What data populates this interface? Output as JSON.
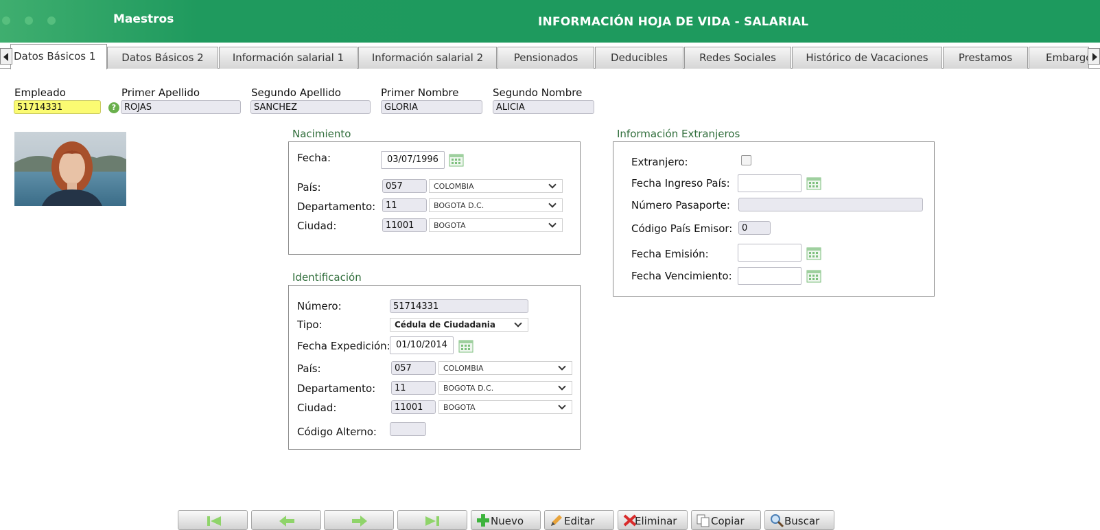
{
  "header": {
    "module": "Maestros",
    "title": "INFORMACIÓN HOJA DE VIDA - SALARIAL"
  },
  "tabs": [
    {
      "label": "Datos Básicos 1",
      "active": true
    },
    {
      "label": "Datos Básicos 2"
    },
    {
      "label": "Información salarial 1"
    },
    {
      "label": "Información salarial 2"
    },
    {
      "label": "Pensionados"
    },
    {
      "label": "Deducibles"
    },
    {
      "label": "Redes Sociales"
    },
    {
      "label": "Histórico de Vacaciones"
    },
    {
      "label": "Prestamos"
    },
    {
      "label": "Embargos"
    }
  ],
  "employee": {
    "label": "Empleado",
    "value": "51714331",
    "first_surname_label": "Primer Apellido",
    "first_surname": "ROJAS",
    "second_surname_label": "Segundo Apellido",
    "second_surname": "SANCHEZ",
    "first_name_label": "Primer Nombre",
    "first_name": "GLORIA",
    "second_name_label": "Segundo Nombre",
    "second_name": "ALICIA"
  },
  "birth": {
    "title": "Nacimiento",
    "date_label": "Fecha:",
    "date": "03/07/1996",
    "country_label": "País:",
    "country_code": "057",
    "country_name": "COLOMBIA",
    "dept_label": "Departamento:",
    "dept_code": "11",
    "dept_name": "BOGOTA D.C.",
    "city_label": "Ciudad:",
    "city_code": "11001",
    "city_name": "BOGOTA"
  },
  "identification": {
    "title": "Identificación",
    "number_label": "Número:",
    "number": "51714331",
    "type_label": "Tipo:",
    "type": "Cédula de Ciudadania",
    "issue_date_label": "Fecha Expedición:",
    "issue_date": "01/10/2014",
    "country_label": "País:",
    "country_code": "057",
    "country_name": "COLOMBIA",
    "dept_label": "Departamento:",
    "dept_code": "11",
    "dept_name": "BOGOTA D.C.",
    "city_label": "Ciudad:",
    "city_code": "11001",
    "city_name": "BOGOTA",
    "alt_code_label": "Código Alterno:",
    "alt_code": ""
  },
  "foreign": {
    "title": "Información Extranjeros",
    "foreigner_label": "Extranjero:",
    "foreigner_checked": false,
    "entry_date_label": "Fecha Ingreso País:",
    "entry_date": "",
    "passport_label": "Número Pasaporte:",
    "passport": "",
    "issuer_country_label": "Código País Emisor:",
    "issuer_country": "0",
    "issue_date_label": "Fecha Emisión:",
    "issue_date": "",
    "expiry_date_label": "Fecha Vencimiento:",
    "expiry_date": ""
  },
  "toolbar": {
    "new_label": "Nuevo",
    "edit_label": "Editar",
    "delete_label": "Eliminar",
    "copy_label": "Copiar",
    "search_label": "Buscar"
  },
  "colors": {
    "header": "#1d9a5e",
    "section_title": "#2f6d3a",
    "employee_field": "#fbfb72"
  }
}
